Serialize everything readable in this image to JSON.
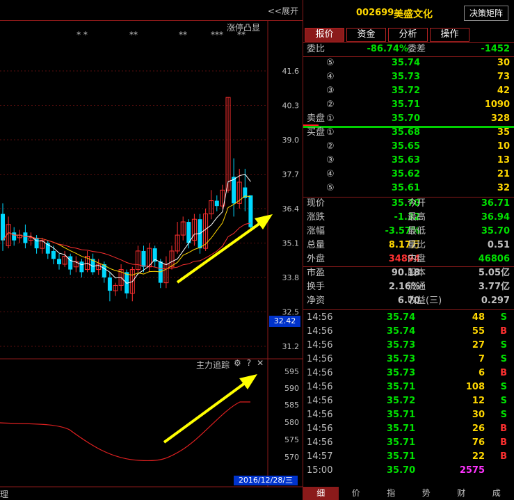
{
  "chart": {
    "expand_label": "<<展开",
    "limit_up_label": "涨停凸显",
    "limit_marks": [
      "* *",
      "**",
      "**",
      "***",
      "**"
    ],
    "price_axis": [
      "41.6",
      "40.3",
      "39.0",
      "37.7",
      "36.4",
      "35.1",
      "33.8",
      "32.5",
      "31.2"
    ],
    "hover_price": "32.42",
    "indicator_title": "主力追踪",
    "indicator_axis": [
      "595",
      "590",
      "585",
      "580",
      "575",
      "570"
    ],
    "date_label": "2016/12/28/三",
    "bottom_left": "理",
    "colors": {
      "up": "#ff3030",
      "down": "#00d8ff",
      "ma5": "#ffffff",
      "ma10": "#ffd700",
      "ma20": "#ff3030",
      "arrow": "#ffff00"
    }
  },
  "chart_data": {
    "type": "candlestick",
    "ylim": [
      31.2,
      41.6
    ],
    "candles": [
      {
        "o": 36.2,
        "c": 35.2,
        "h": 36.6,
        "l": 34.8
      },
      {
        "o": 35.0,
        "c": 35.8,
        "h": 36.1,
        "l": 34.9
      },
      {
        "o": 35.5,
        "c": 35.2,
        "h": 35.7,
        "l": 35.0
      },
      {
        "o": 35.3,
        "c": 35.4,
        "h": 35.6,
        "l": 35.1
      },
      {
        "o": 35.5,
        "c": 35.1,
        "h": 35.8,
        "l": 34.9
      },
      {
        "o": 35.2,
        "c": 35.3,
        "h": 35.5,
        "l": 35.0
      },
      {
        "o": 35.3,
        "c": 34.9,
        "h": 35.4,
        "l": 34.7
      },
      {
        "o": 34.9,
        "c": 35.2,
        "h": 35.3,
        "l": 34.7
      },
      {
        "o": 35.1,
        "c": 34.7,
        "h": 35.2,
        "l": 34.5
      },
      {
        "o": 34.8,
        "c": 34.5,
        "h": 35.0,
        "l": 34.3
      },
      {
        "o": 34.5,
        "c": 34.3,
        "h": 34.7,
        "l": 34.1
      },
      {
        "o": 34.3,
        "c": 34.6,
        "h": 34.8,
        "l": 34.2
      },
      {
        "o": 34.6,
        "c": 34.1,
        "h": 34.7,
        "l": 33.9
      },
      {
        "o": 34.2,
        "c": 34.4,
        "h": 34.6,
        "l": 34.0
      },
      {
        "o": 34.4,
        "c": 34.0,
        "h": 34.5,
        "l": 33.8
      },
      {
        "o": 34.1,
        "c": 34.6,
        "h": 34.8,
        "l": 34.0
      },
      {
        "o": 34.5,
        "c": 34.0,
        "h": 34.7,
        "l": 33.9
      },
      {
        "o": 34.1,
        "c": 34.3,
        "h": 34.5,
        "l": 33.9
      },
      {
        "o": 34.3,
        "c": 33.8,
        "h": 34.4,
        "l": 33.6
      },
      {
        "o": 33.8,
        "c": 33.3,
        "h": 34.0,
        "l": 32.9
      },
      {
        "o": 33.3,
        "c": 33.5,
        "h": 33.6,
        "l": 33.1
      },
      {
        "o": 33.5,
        "c": 34.1,
        "h": 34.3,
        "l": 33.3
      },
      {
        "o": 34.0,
        "c": 33.2,
        "h": 34.1,
        "l": 33.0
      },
      {
        "o": 33.2,
        "c": 34.1,
        "h": 34.2,
        "l": 32.9
      },
      {
        "o": 34.1,
        "c": 34.8,
        "h": 35.0,
        "l": 33.9
      },
      {
        "o": 34.8,
        "c": 34.2,
        "h": 35.0,
        "l": 34.0
      },
      {
        "o": 34.2,
        "c": 34.9,
        "h": 35.1,
        "l": 34.0
      },
      {
        "o": 34.9,
        "c": 34.4,
        "h": 35.0,
        "l": 34.2
      },
      {
        "o": 34.4,
        "c": 33.6,
        "h": 34.5,
        "l": 33.4
      },
      {
        "o": 33.6,
        "c": 34.3,
        "h": 34.6,
        "l": 33.4
      },
      {
        "o": 34.2,
        "c": 34.8,
        "h": 35.0,
        "l": 34.1
      },
      {
        "o": 34.8,
        "c": 35.4,
        "h": 35.9,
        "l": 34.7
      },
      {
        "o": 35.4,
        "c": 35.9,
        "h": 36.1,
        "l": 35.2
      },
      {
        "o": 35.9,
        "c": 35.1,
        "h": 36.0,
        "l": 34.9
      },
      {
        "o": 35.2,
        "c": 36.0,
        "h": 36.2,
        "l": 35.0
      },
      {
        "o": 36.0,
        "c": 34.9,
        "h": 36.2,
        "l": 34.7
      },
      {
        "o": 34.9,
        "c": 36.2,
        "h": 36.4,
        "l": 34.8
      },
      {
        "o": 36.2,
        "c": 36.7,
        "h": 37.1,
        "l": 36.0
      },
      {
        "o": 36.7,
        "c": 36.5,
        "h": 36.9,
        "l": 36.3
      },
      {
        "o": 36.5,
        "c": 37.1,
        "h": 37.3,
        "l": 36.4
      },
      {
        "o": 37.1,
        "c": 40.6,
        "h": 40.6,
        "l": 37.0
      },
      {
        "o": 37.6,
        "c": 36.6,
        "h": 38.3,
        "l": 36.1
      },
      {
        "o": 36.6,
        "c": 37.4,
        "h": 37.9,
        "l": 36.4
      },
      {
        "o": 37.2,
        "c": 36.8,
        "h": 37.9,
        "l": 36.3
      },
      {
        "o": 36.9,
        "c": 35.7,
        "h": 36.9,
        "l": 35.6
      }
    ]
  },
  "panel": {
    "code": "002699",
    "name": "美盛文化",
    "decision_btn": "决策矩阵",
    "tabs": [
      "报价",
      "资金",
      "分析",
      "操作"
    ],
    "weibi_label": "委比",
    "weibi_value": "-86.74%",
    "weicha_label": "委差",
    "weicha_value": "-1452",
    "sell_label": "卖盘",
    "buy_label": "买盘",
    "sells": [
      {
        "idx": "⑤",
        "price": "35.74",
        "vol": "30"
      },
      {
        "idx": "④",
        "price": "35.73",
        "vol": "73"
      },
      {
        "idx": "③",
        "price": "35.72",
        "vol": "42"
      },
      {
        "idx": "②",
        "price": "35.71",
        "vol": "1090"
      },
      {
        "idx": "①",
        "price": "35.70",
        "vol": "328"
      }
    ],
    "buys": [
      {
        "idx": "①",
        "price": "35.68",
        "vol": "35"
      },
      {
        "idx": "②",
        "price": "35.65",
        "vol": "10"
      },
      {
        "idx": "③",
        "price": "35.63",
        "vol": "13"
      },
      {
        "idx": "④",
        "price": "35.62",
        "vol": "21"
      },
      {
        "idx": "⑤",
        "price": "35.61",
        "vol": "32"
      }
    ],
    "stats": [
      {
        "l1": "现价",
        "v1": "35.70",
        "c1": "#00e000",
        "l2": "今开",
        "v2": "36.71",
        "c2": "#00e000"
      },
      {
        "l1": "涨跌",
        "v1": "-1.32",
        "c1": "#00e000",
        "l2": "最高",
        "v2": "36.94",
        "c2": "#00e000"
      },
      {
        "l1": "涨幅",
        "v1": "-3.57%",
        "c1": "#00e000",
        "l2": "最低",
        "v2": "35.70",
        "c2": "#00e000"
      },
      {
        "l1": "总量",
        "v1": "8.17万",
        "c1": "#ffd700",
        "l2": "量比",
        "v2": "0.51",
        "c2": "#c0c0c0"
      },
      {
        "l1": "外盘",
        "v1": "34894",
        "c1": "#ff3030",
        "l2": "内盘",
        "v2": "46806",
        "c2": "#00e000"
      }
    ],
    "stats2": [
      {
        "l1": "市盈",
        "v1": "90.18",
        "l2": "股本",
        "v2": "5.05亿"
      },
      {
        "l1": "换手",
        "v1": "2.16%",
        "l2": "流通",
        "v2": "3.77亿"
      },
      {
        "l1": "净资",
        "v1": "6.70",
        "l2": "收益(三)",
        "v2": "0.297"
      }
    ],
    "ticks": [
      {
        "t": "14:56",
        "p": "35.74",
        "v": "48",
        "d": "S"
      },
      {
        "t": "14:56",
        "p": "35.74",
        "v": "55",
        "d": "B"
      },
      {
        "t": "14:56",
        "p": "35.73",
        "v": "27",
        "d": "S"
      },
      {
        "t": "14:56",
        "p": "35.73",
        "v": "7",
        "d": "S"
      },
      {
        "t": "14:56",
        "p": "35.73",
        "v": "6",
        "d": "B"
      },
      {
        "t": "14:56",
        "p": "35.71",
        "v": "108",
        "d": "S"
      },
      {
        "t": "14:56",
        "p": "35.72",
        "v": "12",
        "d": "S"
      },
      {
        "t": "14:56",
        "p": "35.71",
        "v": "30",
        "d": "S"
      },
      {
        "t": "14:56",
        "p": "35.71",
        "v": "26",
        "d": "B"
      },
      {
        "t": "14:56",
        "p": "35.71",
        "v": "76",
        "d": "B"
      },
      {
        "t": "14:57",
        "p": "35.71",
        "v": "22",
        "d": "B"
      },
      {
        "t": "15:00",
        "p": "35.70",
        "v": "2575",
        "d": ""
      }
    ],
    "bottom_tabs": [
      "细",
      "价",
      "指",
      "势",
      "财",
      "成"
    ]
  }
}
